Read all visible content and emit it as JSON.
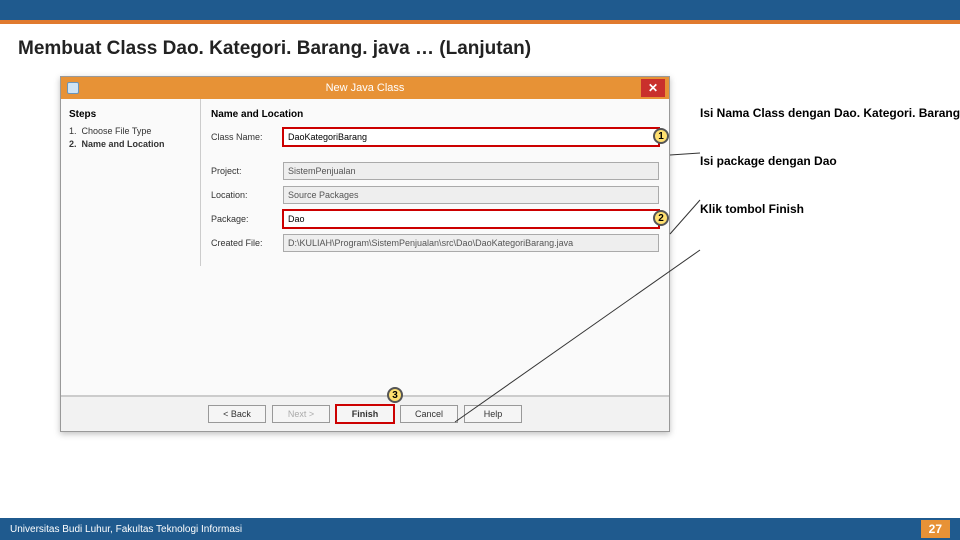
{
  "slide": {
    "title": "Membuat Class Dao. Kategori. Barang. java … (Lanjutan)"
  },
  "dialog": {
    "title": "New Java Class",
    "close_glyph": "✕",
    "steps_header": "Steps",
    "steps": [
      "Choose File Type",
      "Name and Location"
    ],
    "form_header": "Name and Location",
    "labels": {
      "class_name": "Class Name:",
      "project": "Project:",
      "location": "Location:",
      "package": "Package:",
      "created": "Created File:"
    },
    "values": {
      "class_name": "DaoKategoriBarang",
      "project": "SistemPenjualan",
      "location": "Source Packages",
      "package": "Dao",
      "created": "D:\\KULIAH\\Program\\SistemPenjualan\\src\\Dao\\DaoKategoriBarang.java"
    },
    "buttons": {
      "back": "< Back",
      "next": "Next >",
      "finish": "Finish",
      "cancel": "Cancel",
      "help": "Help"
    }
  },
  "callouts": {
    "m1": "1",
    "m2": "2",
    "m3": "3",
    "a1": "Isi Nama Class dengan Dao. Kategori. Barang",
    "a2": "Isi package dengan Dao",
    "a3": "Klik tombol Finish"
  },
  "footer": {
    "org": "Universitas Budi Luhur, Fakultas Teknologi Informasi",
    "page": "27"
  }
}
